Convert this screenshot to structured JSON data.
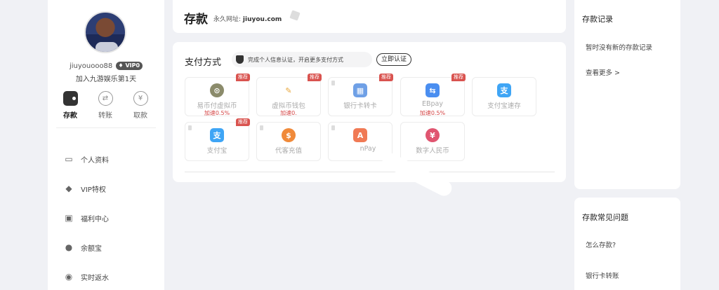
{
  "user": {
    "username": "jiuyouooo88",
    "vip": "VIP0",
    "joined": "加入九游娱乐第1天"
  },
  "funds": [
    {
      "label": "存款",
      "icon": "wallet-icon"
    },
    {
      "label": "转账",
      "icon": "transfer-icon"
    },
    {
      "label": "取款",
      "icon": "yen-icon"
    }
  ],
  "menu": [
    {
      "label": "个人资料",
      "icon": "id-card-icon"
    },
    {
      "label": "VIP特权",
      "icon": "diamond-icon"
    },
    {
      "label": "福利中心",
      "icon": "gift-icon"
    },
    {
      "label": "余额宝",
      "icon": "money-bag-icon"
    },
    {
      "label": "实时返水",
      "icon": "rebate-icon"
    }
  ],
  "header": {
    "title": "存款",
    "url_label": "永久网址:",
    "url": "jiuyou.com"
  },
  "payment": {
    "title": "支付方式",
    "verify_tip": "完成个人信息认证，开启更多支付方式",
    "verify_button": "立即认证",
    "recommend_label": "推荐",
    "methods": [
      {
        "name": "易币付虚拟币",
        "speed": "加速0.5%",
        "recommend": true,
        "icon": "ebi-coin-icon",
        "color": "#8b8b6b"
      },
      {
        "name": "虚拟币钱包",
        "speed": "加速0.",
        "recommend": true,
        "icon": "crypto-wallet-icon",
        "color": "#e8a63a"
      },
      {
        "name": "银行卡转卡",
        "speed": "",
        "recommend": true,
        "icon": "bank-card-icon",
        "color": "#6fa0e6"
      },
      {
        "name": "EBpay",
        "speed": "加速0.5%",
        "recommend": true,
        "icon": "ebpay-icon",
        "color": "#4a8ef0"
      },
      {
        "name": "支付宝速存",
        "speed": "",
        "recommend": false,
        "icon": "alipay-fast-icon",
        "color": "#3fa5f5"
      },
      {
        "name": "支付宝",
        "speed": "",
        "recommend": true,
        "icon": "alipay-icon",
        "color": "#3fa5f5"
      },
      {
        "name": "代客充值",
        "speed": "",
        "recommend": false,
        "icon": "agent-topup-icon",
        "color": "#f08a3a"
      },
      {
        "name": "nPay",
        "speed": "",
        "recommend": false,
        "icon": "apay-icon",
        "color": "#f07a55"
      },
      {
        "name": "数字人民币",
        "speed": "",
        "recommend": false,
        "icon": "digital-rmb-icon",
        "color": "#e05570"
      }
    ]
  },
  "records": {
    "title": "存款记录",
    "empty": "暂时没有新的存款记录",
    "more": "查看更多 >"
  },
  "faq": {
    "title": "存款常见问题",
    "items": [
      "怎么存款?",
      "银行卡转账"
    ]
  }
}
